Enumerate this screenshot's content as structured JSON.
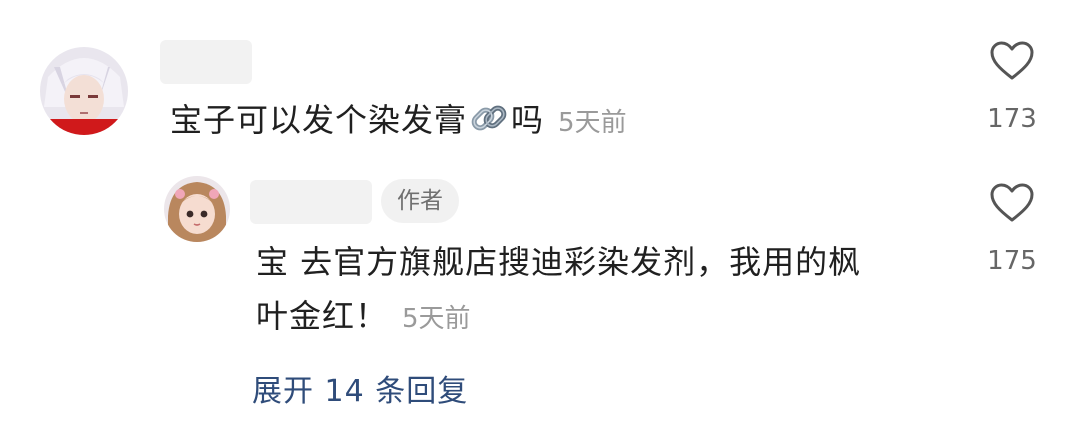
{
  "comments": [
    {
      "text": "宝子可以发个染发膏",
      "text_after": "吗",
      "emoji": "link-icon",
      "time": "5天前",
      "likes": "173"
    }
  ],
  "reply": {
    "badge": "作者",
    "line1": "宝 去官方旗舰店搜迪彩染发剂，我用的枫",
    "line2": "叶金红！",
    "time": "5天前",
    "likes": "175"
  },
  "expand_label": "展开 14 条回复",
  "colors": {
    "expand": "#2f4c7a",
    "time": "#9a9a9a",
    "badge_bg": "#f1f1f1"
  }
}
